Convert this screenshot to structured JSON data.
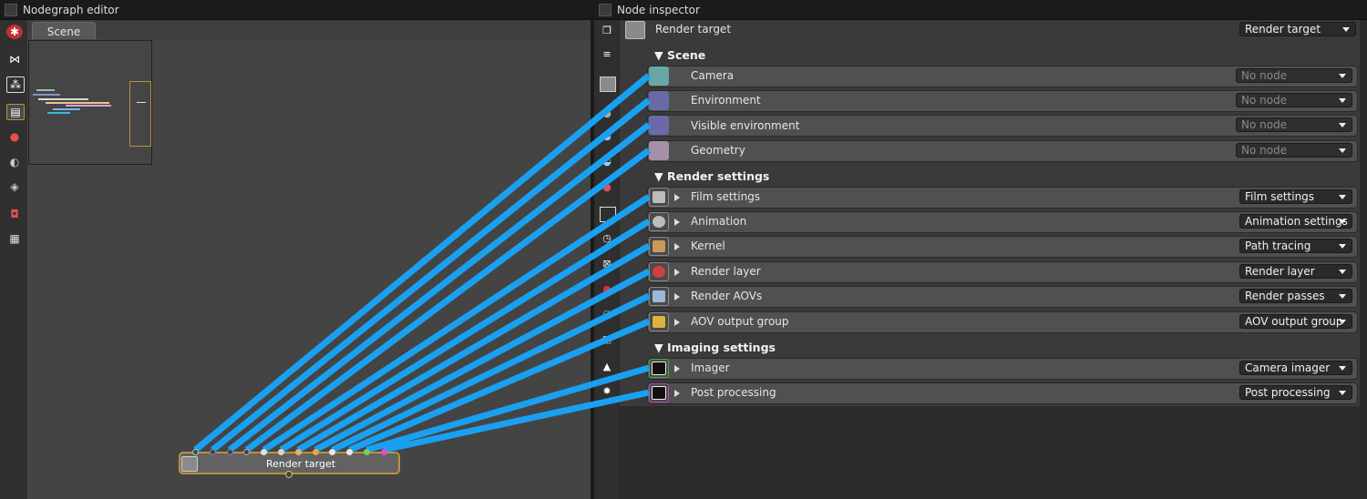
{
  "nodegraph": {
    "title": "Nodegraph editor",
    "tab": "Scene",
    "node": {
      "label": "Render target",
      "port_colors": [
        "#9ad0c8",
        "#8080c0",
        "#8080c0",
        "#c0a0c0",
        "#e0e0e0",
        "#e0d0c0",
        "#e0b070",
        "#f0a050",
        "#e8e8e8",
        "#e8e8e8",
        "#70d070",
        "#e050d0"
      ]
    }
  },
  "inspector": {
    "title": "Node inspector",
    "header": {
      "label": "Render target",
      "value": "Render target"
    },
    "sections": {
      "scene": "Scene",
      "render_settings": "Render settings",
      "imaging_settings": "Imaging settings"
    },
    "rows": [
      {
        "label": "Camera",
        "value": "No node",
        "color": "#6aa6a3"
      },
      {
        "label": "Environment",
        "value": "No node",
        "color": "#6a6aa8"
      },
      {
        "label": "Visible environment",
        "value": "No node",
        "color": "#6a6aa8"
      },
      {
        "label": "Geometry",
        "value": "No node",
        "color": "#a88fa8"
      },
      {
        "label": "Film settings",
        "value": "Film settings",
        "color": "#bcbcbc"
      },
      {
        "label": "Animation",
        "value": "Animation settings",
        "color": "#bcbcbc"
      },
      {
        "label": "Kernel",
        "value": "Path tracing",
        "color": "#c89a5a"
      },
      {
        "label": "Render layer",
        "value": "Render layer",
        "color": "#d04040"
      },
      {
        "label": "Render AOVs",
        "value": "Render passes",
        "color": "#a0b8d8"
      },
      {
        "label": "AOV output group",
        "value": "AOV output group",
        "color": "#e0b040"
      },
      {
        "label": "Imager",
        "value": "Camera imager",
        "color": "#40b040"
      },
      {
        "label": "Post processing",
        "value": "Post processing",
        "color": "#c040c0"
      }
    ]
  },
  "colors": {
    "wire": "#1aa0f0",
    "selection": "#b7933b"
  }
}
